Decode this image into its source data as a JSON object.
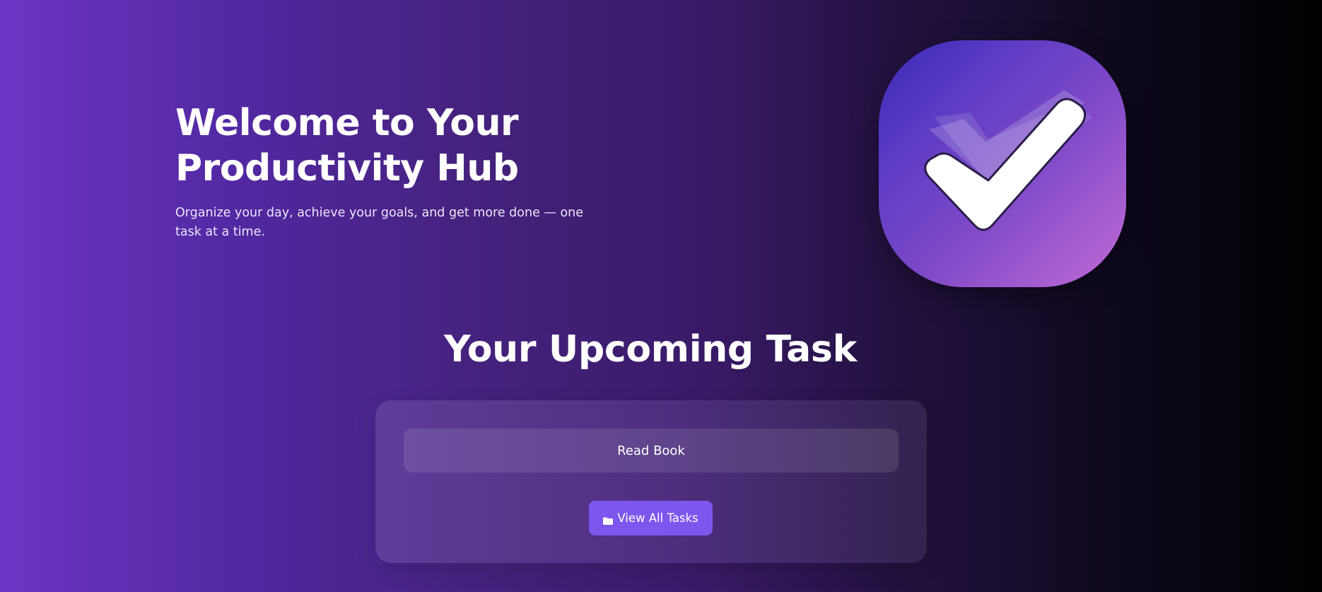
{
  "hero": {
    "title_line1": "Welcome to Your",
    "title_line2": "Productivity Hub",
    "subtitle": "Organize your day, achieve your goals, and get more done — one task at a time.",
    "logo_icon": "checkmark-icon"
  },
  "upcoming": {
    "heading": "Your Upcoming Task",
    "task": "Read Book",
    "view_button": {
      "icon": "folder-icon",
      "label": "View All Tasks"
    }
  },
  "colors": {
    "button": "#7d56ee",
    "gradient_start": "#6d35c4",
    "gradient_end": "#000000"
  }
}
